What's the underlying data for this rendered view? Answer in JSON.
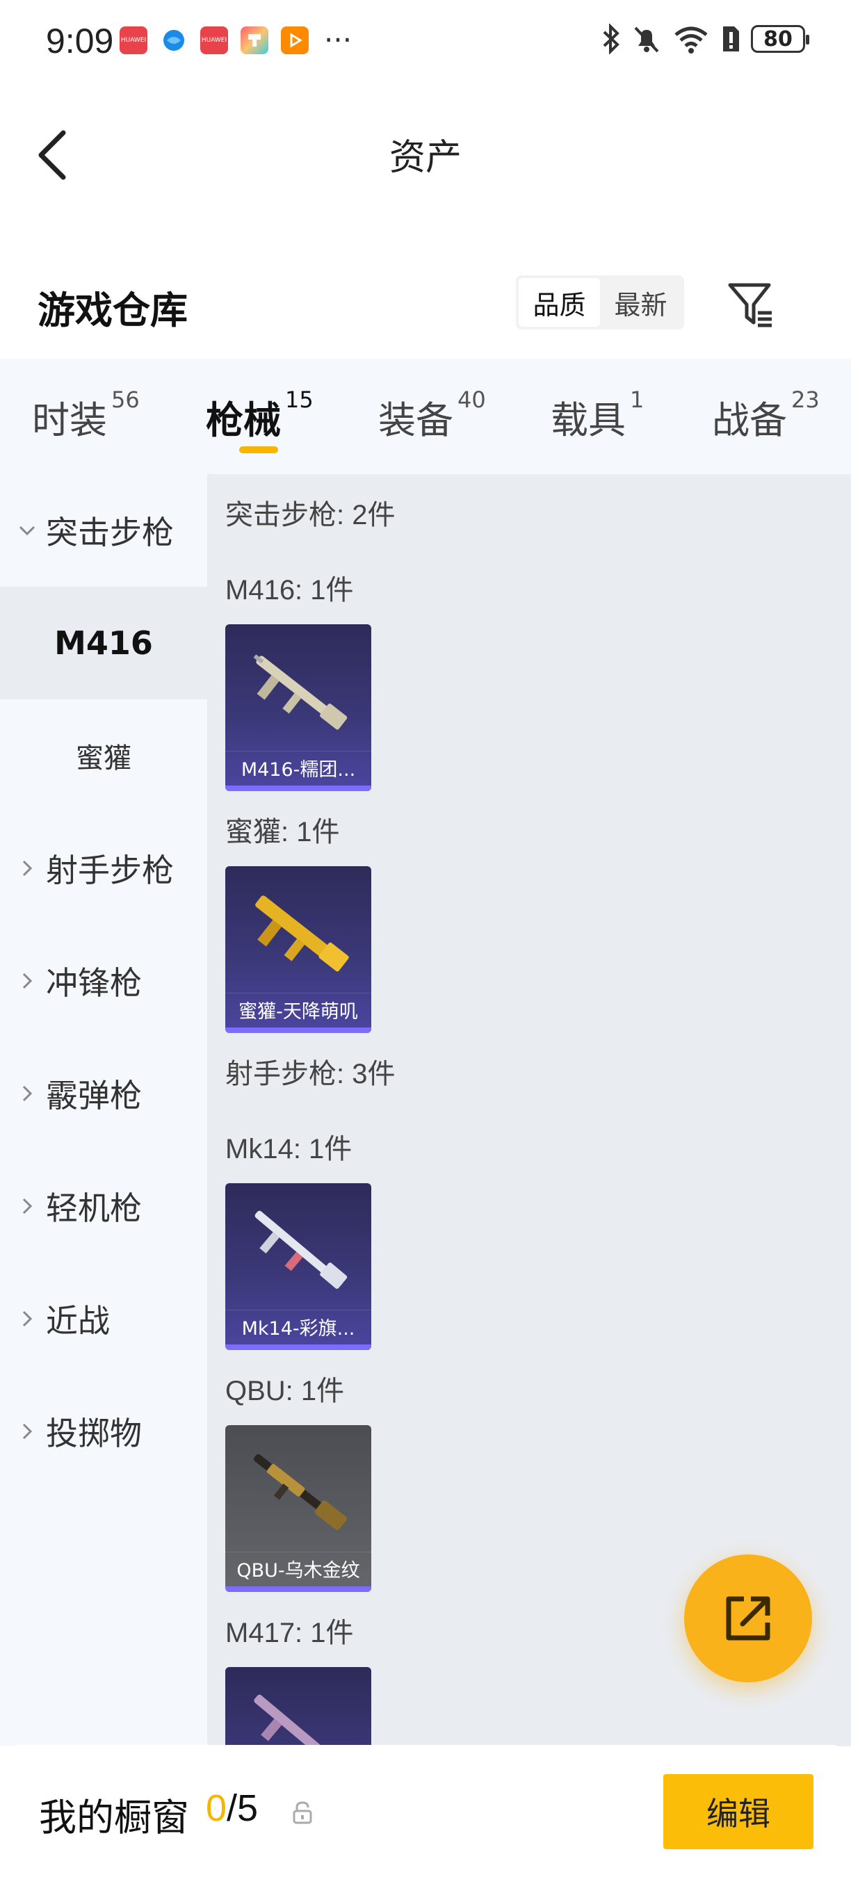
{
  "status_bar": {
    "time": "9:09",
    "notifications": [
      {
        "icon": "huawei-app-icon",
        "color": "#e8434a",
        "label": "HUAWEI"
      },
      {
        "icon": "browser-app-icon",
        "color": "#1b8ae8",
        "label": ""
      },
      {
        "icon": "huawei-app-icon-2",
        "color": "#e8434a",
        "label": "HUAWEI"
      },
      {
        "icon": "colorful-app-icon",
        "color": "#f5a623",
        "label": ""
      },
      {
        "icon": "video-app-icon",
        "color": "#ff8a00",
        "label": ""
      }
    ],
    "more": "···",
    "battery": "80"
  },
  "nav": {
    "title": "资产"
  },
  "warehouse": {
    "title": "游戏仓库",
    "sort_options": [
      "品质",
      "最新"
    ],
    "active_sort": "品质"
  },
  "tabs": [
    {
      "label": "时装",
      "count": "56"
    },
    {
      "label": "枪械",
      "count": "15"
    },
    {
      "label": "装备",
      "count": "40"
    },
    {
      "label": "载具",
      "count": "1"
    },
    {
      "label": "战备",
      "count": "23"
    }
  ],
  "sidebar": {
    "categories": [
      {
        "label": "突击步枪",
        "expanded": true
      },
      {
        "label": "射手步枪"
      },
      {
        "label": "冲锋枪"
      },
      {
        "label": "霰弹枪"
      },
      {
        "label": "轻机枪"
      },
      {
        "label": "近战"
      },
      {
        "label": "投掷物"
      }
    ],
    "subitems": [
      {
        "label": "M416",
        "active": true
      },
      {
        "label": "蜜獾"
      }
    ]
  },
  "content": {
    "sections": [
      {
        "label": "突击步枪: 2件"
      },
      {
        "label": "M416: 1件"
      },
      {
        "label": "蜜獾: 1件"
      },
      {
        "label": "射手步枪: 3件"
      },
      {
        "label": "Mk14: 1件"
      },
      {
        "label": "QBU: 1件"
      },
      {
        "label": "M417: 1件"
      }
    ],
    "items": [
      {
        "name": "M416-糯团...",
        "rarity": "epic"
      },
      {
        "name": "蜜獾-天降萌叽",
        "rarity": "epic"
      },
      {
        "name": "Mk14-彩旗...",
        "rarity": "epic"
      },
      {
        "name": "QBU-乌木金纹",
        "rarity": "rare"
      },
      {
        "name": "",
        "rarity": "epic"
      }
    ]
  },
  "showcase": {
    "title": "我的橱窗",
    "current": "0",
    "total": "/5",
    "edit_label": "编辑"
  },
  "colors": {
    "accent": "#f7b500",
    "fab": "#f9b21a",
    "edit_button": "#fbbd08",
    "epic_card": "#3b3878",
    "rare_card": "#5a5c61"
  }
}
